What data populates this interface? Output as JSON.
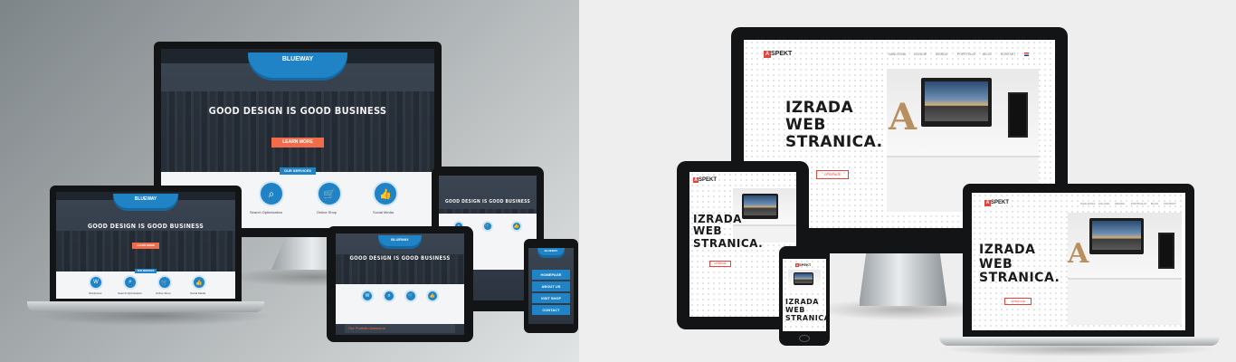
{
  "blueway": {
    "brand": "BLUEWAY",
    "headline": "GOOD DESIGN IS GOOD BUSINESS",
    "cta": "LEARN MORE",
    "services_title": "OUR SERVICES",
    "services": [
      "Search Optimization",
      "Online Shop",
      "Social Media"
    ],
    "services_small": [
      "Wordpress",
      "Search Optimization",
      "Online Shop",
      "Social Media"
    ],
    "phone_menu": [
      "HOMEPAGE",
      "ABOUT US",
      "VISIT SHOP",
      "CONTACT"
    ],
    "tablet_footer": "Our Portfolio Awesome"
  },
  "aspekt": {
    "logo_letter": "A",
    "logo_text": "SPEKT",
    "headline_1": "IZRADA",
    "headline_2": "WEB",
    "headline_3": "STRANICA.",
    "cta": "OPŠIRNIJE",
    "nav": [
      "NASLOVNA",
      "USLUGE",
      "IZRADA",
      "PORTFOLIO",
      "BLOG",
      "KONTAKT"
    ]
  },
  "colors": {
    "blueway_accent": "#1f83c6",
    "blueway_cta": "#f06c4b",
    "aspekt_accent": "#e2453c",
    "device_bezel": "#121416"
  }
}
